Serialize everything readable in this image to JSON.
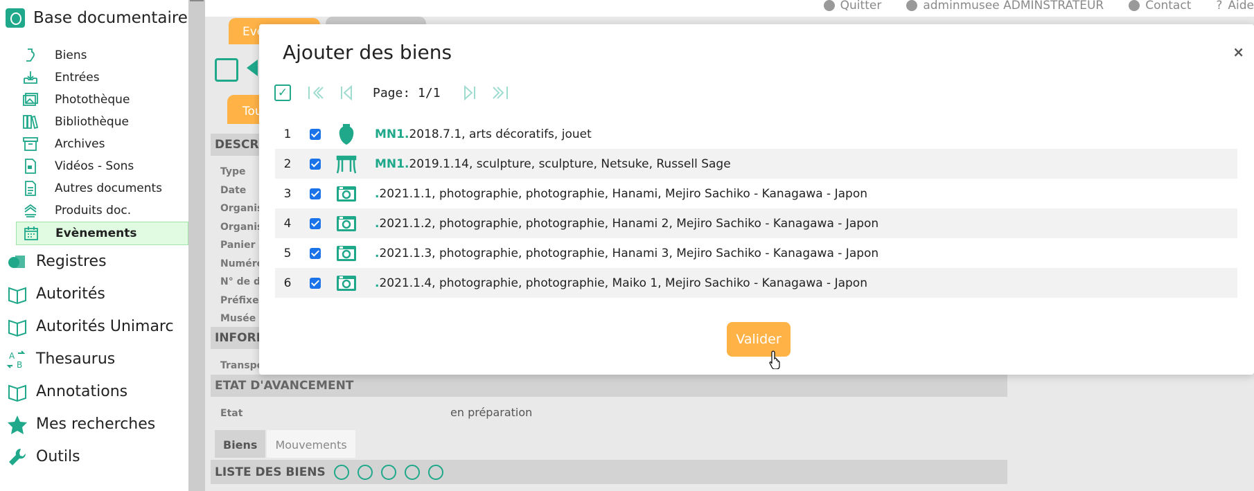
{
  "sidebar": {
    "brand": "Base documentaire",
    "sub_items": [
      {
        "label": "Biens",
        "icon": "object-icon"
      },
      {
        "label": "Entrées",
        "icon": "inbox-download-icon"
      },
      {
        "label": "Photothèque",
        "icon": "images-icon"
      },
      {
        "label": "Bibliothèque",
        "icon": "books-icon"
      },
      {
        "label": "Archives",
        "icon": "archive-box-icon"
      },
      {
        "label": "Vidéos - Sons",
        "icon": "video-file-icon"
      },
      {
        "label": "Autres documents",
        "icon": "document-icon"
      },
      {
        "label": "Produits doc.",
        "icon": "stack-icon"
      },
      {
        "label": "Evènements",
        "icon": "calendar-icon",
        "active": true
      }
    ],
    "main_items": [
      {
        "label": "Registres",
        "icon": "registers-icon"
      },
      {
        "label": "Autorités",
        "icon": "book-open-icon"
      },
      {
        "label": "Autorités Unimarc",
        "icon": "book-open-icon"
      },
      {
        "label": "Thesaurus",
        "icon": "thesaurus-icon"
      },
      {
        "label": "Annotations",
        "icon": "book-open-icon"
      },
      {
        "label": "Mes recherches",
        "icon": "star-icon"
      },
      {
        "label": "Outils",
        "icon": "wrench-icon"
      }
    ]
  },
  "header": {
    "quit": "Quitter",
    "user": "adminmusee ADMINSTRATEUR",
    "contact": "Contact",
    "help": "Aide"
  },
  "background": {
    "tab_event": "Eve",
    "tab_tou": "Tou",
    "section_descr": "DESCRI",
    "fields": [
      "Type",
      "Date",
      "Organis",
      "Organis",
      "Panier r",
      "Numéro",
      "N° de d",
      "Préfixe",
      "Musée"
    ],
    "section_inform": "INFORM",
    "transport": "Transpo",
    "section_etat": "ETAT D'AVANCEMENT",
    "etat_label": "Etat",
    "etat_value": "en préparation",
    "tab_biens": "Biens",
    "tab_mouvements": "Mouvements",
    "liste_title": "LISTE DES BIENS"
  },
  "modal": {
    "title": "Ajouter des biens",
    "close": "×",
    "page_label": "Page: 1/1",
    "valider": "Valider",
    "rows": [
      {
        "num": "1",
        "prefix": "MN1.",
        "rest": "2018.7.1, arts décoratifs, jouet",
        "thumb": "vase-icon"
      },
      {
        "num": "2",
        "prefix": "MN1.",
        "rest": "2019.1.14, sculpture, sculpture, Netsuke, Russell Sage",
        "thumb": "table-icon"
      },
      {
        "num": "3",
        "prefix": ".",
        "rest": "2021.1.1, photographie, photographie, Hanami, Mejiro Sachiko - Kanagawa - Japon",
        "thumb": "camera-icon"
      },
      {
        "num": "4",
        "prefix": ".",
        "rest": "2021.1.2, photographie, photographie, Hanami 2, Mejiro Sachiko - Kanagawa - Japon",
        "thumb": "camera-icon"
      },
      {
        "num": "5",
        "prefix": ".",
        "rest": "2021.1.3, photographie, photographie, Hanami 3, Mejiro Sachiko - Kanagawa - Japon",
        "thumb": "camera-icon"
      },
      {
        "num": "6",
        "prefix": ".",
        "rest": "2021.1.4, photographie, photographie, Maiko 1, Mejiro Sachiko - Kanagawa - Japon",
        "thumb": "camera-icon"
      }
    ]
  },
  "colors": {
    "accent": "#1fa88a",
    "orange": "#ffb347"
  }
}
